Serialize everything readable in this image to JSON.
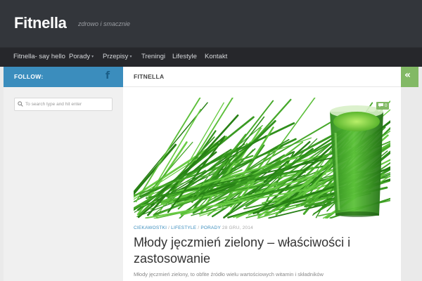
{
  "site": {
    "title": "Fitnella",
    "tagline": "zdrowo i smacznie"
  },
  "nav": {
    "items": [
      {
        "label": "Fitnella- say hello",
        "has_submenu": false
      },
      {
        "label": "Porady",
        "has_submenu": true
      },
      {
        "label": "Przepisy",
        "has_submenu": true
      },
      {
        "label": "Treningi",
        "has_submenu": false
      },
      {
        "label": "Lifestyle",
        "has_submenu": false
      },
      {
        "label": "Kontakt",
        "has_submenu": false
      }
    ],
    "submenu_caret": "▾"
  },
  "sidebar": {
    "follow_label": "FOLLOW:",
    "facebook_icon": "f",
    "search": {
      "placeholder": "To search type and hit enter",
      "value": ""
    }
  },
  "main": {
    "header_title": "FITNELLA",
    "toggle_icon": "«"
  },
  "post": {
    "comment_icon": "comment-icon",
    "comment_count": "0",
    "categories": [
      "CIEKAWOSTKI",
      "LIFESTYLE",
      "PORADY"
    ],
    "category_separator": "/",
    "date": "28 GRU, 2014",
    "title": "Młody jęczmień zielony – właściwości i zastosowanie",
    "excerpt": "Młody jęczmień zielony, to obfite źródło wielu wartościowych witamin i składników"
  },
  "colors": {
    "header_bg": "#33363b",
    "nav_bg": "#26272b",
    "follow_bar": "#3b8dbd",
    "accent_green": "#82b965",
    "link_blue": "#3b8dbd"
  }
}
